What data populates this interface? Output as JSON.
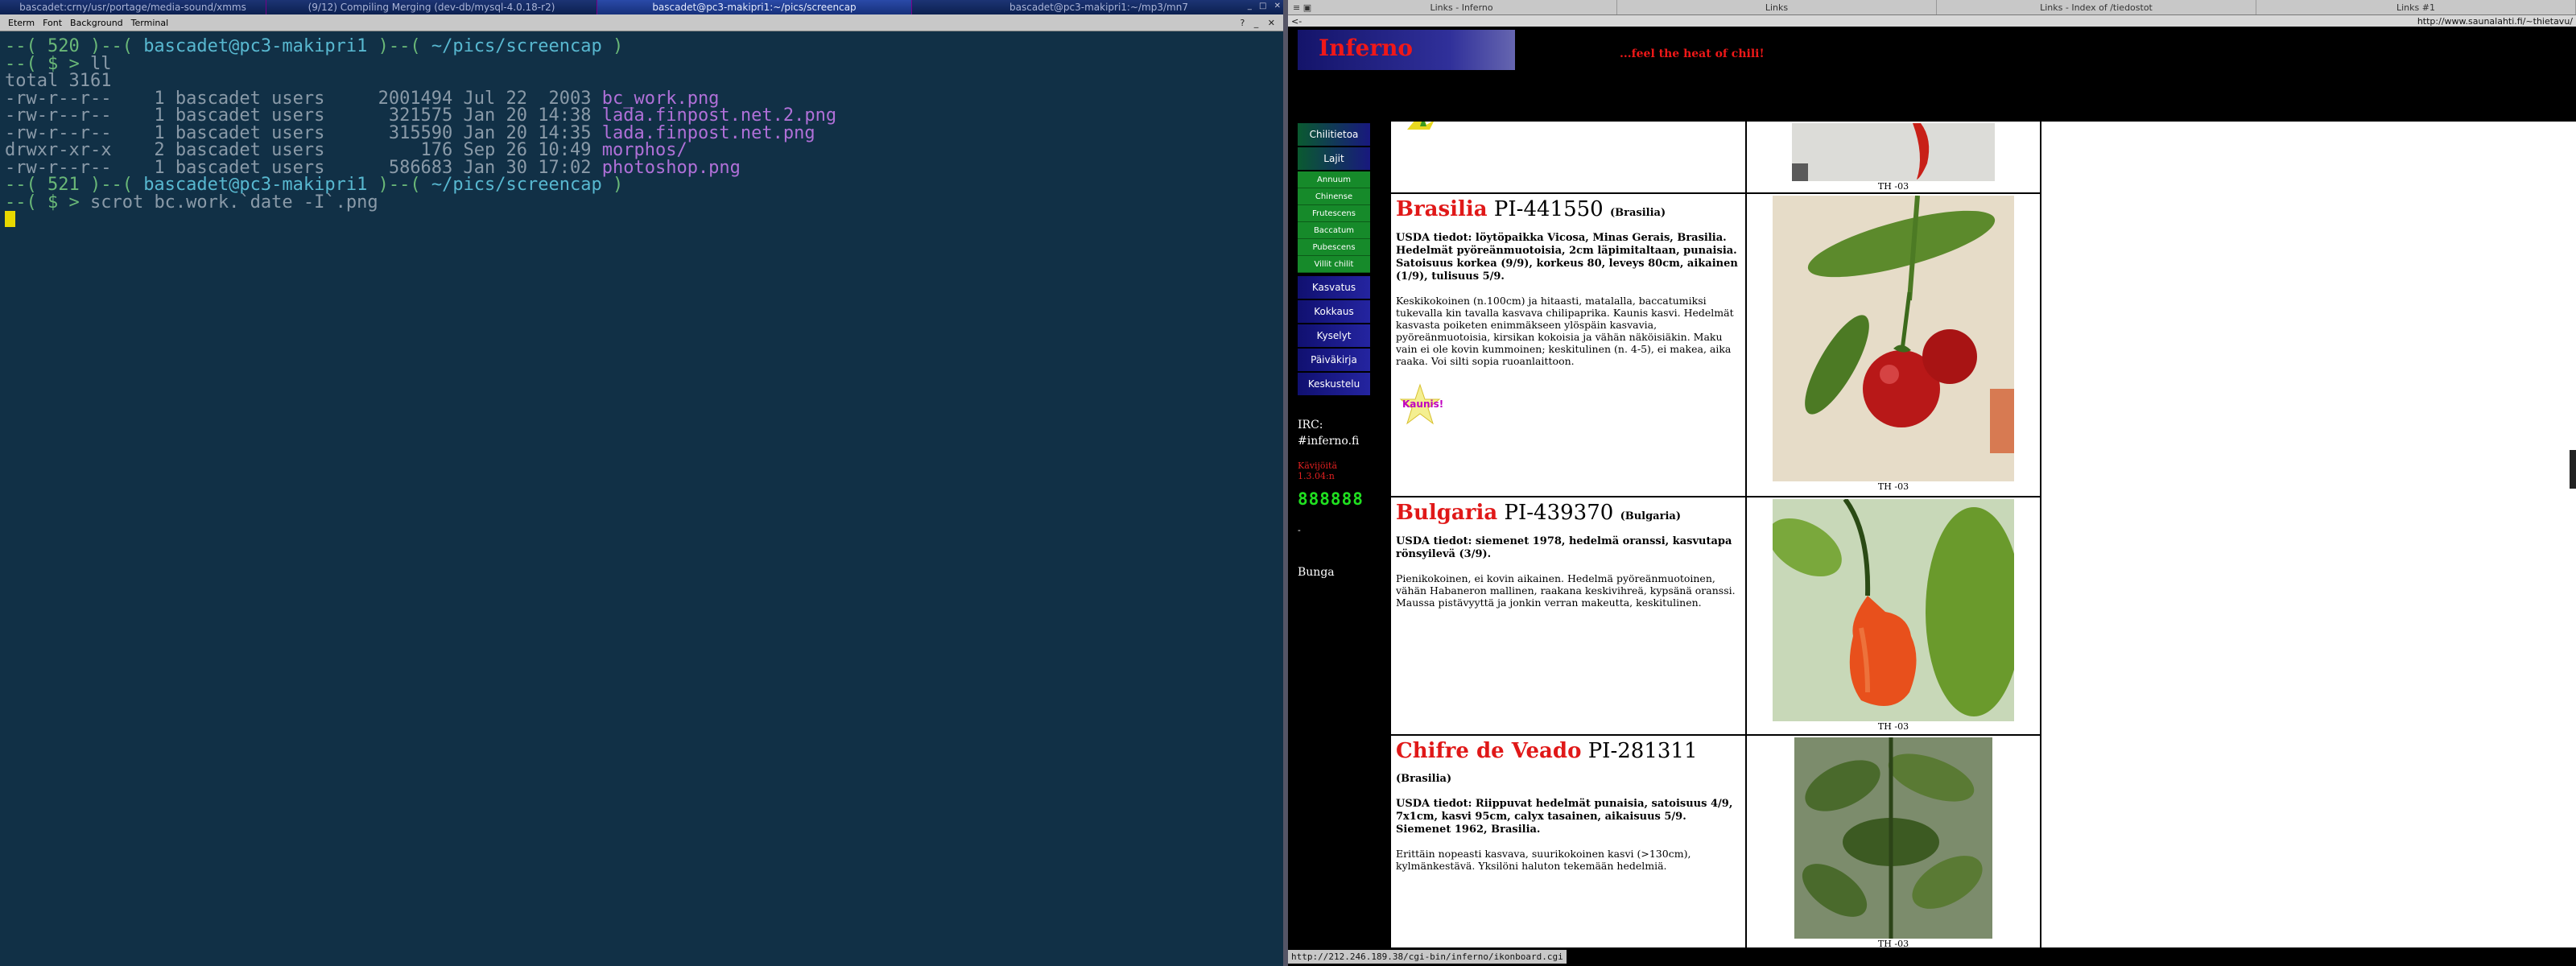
{
  "taskbar": {
    "tabs": [
      {
        "label": "bascadet:crny/usr/portage/media-sound/xmms",
        "active": false
      },
      {
        "label": "(9/12) Compiling Merging (dev-db/mysql-4.0.18-r2)",
        "active": false
      },
      {
        "label": "bascadet@pc3-makipri1:~/pics/screencap",
        "active": true
      },
      {
        "label": "bascadet@pc3-makipri1:~/mp3/mn7",
        "active": false
      }
    ]
  },
  "terminal": {
    "menu": [
      "Eterm",
      "Font",
      "Background",
      "Terminal"
    ],
    "lines": [
      [
        {
          "t": "--( 520 )--( ",
          "c": "green"
        },
        {
          "t": "bascadet@pc3-makipri1",
          "c": "cyan"
        },
        {
          "t": " )--( ",
          "c": "green"
        },
        {
          "t": "~/pics/screencap",
          "c": "cyan"
        },
        {
          "t": " )",
          "c": "green"
        }
      ],
      [
        {
          "t": "--( $ > ",
          "c": "green"
        },
        {
          "t": "ll",
          "c": "dim"
        }
      ],
      [
        {
          "t": "total 3161",
          "c": "dim"
        }
      ],
      [
        {
          "t": "-rw-r--r--    1 bascadet users     2001494 Jul 22  2003 ",
          "c": "dim"
        },
        {
          "t": "bc_work.png",
          "c": "mag"
        }
      ],
      [
        {
          "t": "-rw-r--r--    1 bascadet users      321575 Jan 20 14:38 ",
          "c": "dim"
        },
        {
          "t": "lada.finpost.net.2.png",
          "c": "mag"
        }
      ],
      [
        {
          "t": "-rw-r--r--    1 bascadet users      315590 Jan 20 14:35 ",
          "c": "dim"
        },
        {
          "t": "lada.finpost.net.png",
          "c": "mag"
        }
      ],
      [
        {
          "t": "drwxr-xr-x    2 bascadet users         176 Sep 26 10:49 ",
          "c": "dim"
        },
        {
          "t": "morphos/",
          "c": "mag"
        }
      ],
      [
        {
          "t": "-rw-r--r--    1 bascadet users      586683 Jan 30 17:02 ",
          "c": "dim"
        },
        {
          "t": "photoshop.png",
          "c": "mag"
        }
      ],
      [
        {
          "t": "--( 521 )--( ",
          "c": "green"
        },
        {
          "t": "bascadet@pc3-makipri1",
          "c": "cyan"
        },
        {
          "t": " )--( ",
          "c": "green"
        },
        {
          "t": "~/pics/screencap",
          "c": "cyan"
        },
        {
          "t": " )",
          "c": "green"
        }
      ],
      [
        {
          "t": "--( $ > ",
          "c": "green"
        },
        {
          "t": "scrot bc.work.`date -I`.png",
          "c": "dim"
        }
      ]
    ]
  },
  "browser": {
    "tabs": [
      "Links - Inferno",
      "Links",
      "Links - Index of /tiedostot",
      "Links #1"
    ],
    "back_symbol": "<-",
    "url": "http://www.saunalahti.fi/~thietavu/",
    "site_logo": "Inferno",
    "tagline": "...feel the heat of chili!",
    "nav_main": [
      "Chilitietoa",
      "Lajit"
    ],
    "nav_sub": [
      "Annuum",
      "Chinense",
      "Frutescens",
      "Baccatum",
      "Pubescens",
      "Villit chilit"
    ],
    "nav_more": [
      "Kasvatus",
      "Kokkaus",
      "Kyselyt",
      "Päiväkirja",
      "Keskustelu"
    ],
    "irc_label": "IRC:",
    "irc_channel": "#inferno.fi",
    "visits_label": "Kävijöitä",
    "visits_since": "1.3.04:n",
    "counter": "888888",
    "dot": "-",
    "bunga": "Bunga",
    "top_caption": "TH -03",
    "peppers": [
      {
        "name": "Brasilia",
        "pi": "PI-441550",
        "country": "(Brasilia)",
        "usda": "USDA tiedot: löytöpaikka Vicosa, Minas Gerais, Brasilia. Hedelmät pyöreänmuotoisia, 2cm läpimitaltaan, punaisia. Satoisuus korkea (9/9), korkeus 80, leveys 80cm, aikainen (1/9), tulisuus 5/9.",
        "desc": "Keskikokoinen (n.100cm) ja hitaasti, matalalla, baccatumiksi tukevalla kin tavalla kasvava chilipaprika. Kaunis kasvi. Hedelmät kasvasta poiketen enimmäkseen ylöspäin kasvavia, pyöreänmuotoisia, kirsikan kokoisia ja vähän näköisiäkin. Maku vain ei ole kovin kummoinen; keskitulinen (n. 4-5), ei makea, aika raaka. Voi silti sopia ruoanlaittoon.",
        "badge": "Kaunis!",
        "caption": "TH -03"
      },
      {
        "name": "Bulgaria",
        "pi": "PI-439370",
        "country": "(Bulgaria)",
        "usda": "USDA tiedot: siemenet 1978, hedelmä oranssi, kasvutapa rönsyilevä (3/9).",
        "desc": "Pienikokoinen, ei kovin aikainen. Hedelmä pyöreänmuotoinen, vähän Habaneron mallinen, raakana keskivihreä, kypsänä oranssi. Maussa pistävyyttä ja jonkin verran makeutta, keskitulinen.",
        "badge": "",
        "caption": "TH -03"
      },
      {
        "name": "Chifre de Veado",
        "pi": "PI-281311",
        "country": "(Brasilia)",
        "usda": "USDA tiedot: Riippuvat hedelmät punaisia, satoisuus 4/9, 7x1cm, kasvi 95cm, calyx tasainen, aikaisuus 5/9. Siemenet 1962, Brasilia.",
        "desc": "Erittäin nopeasti kasvava, suurikokoinen kasvi (>130cm), kylmänkestävä. Yksilöni haluton tekemään hedelmiä.",
        "badge": "",
        "caption": "TH -03"
      }
    ],
    "status_url": "http://212.246.189.38/cgi-bin/inferno/ikonboard.cgi"
  }
}
